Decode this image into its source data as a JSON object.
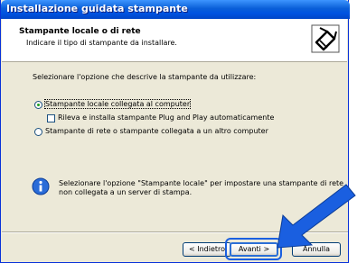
{
  "window": {
    "title": "Installazione guidata stampante"
  },
  "header": {
    "title": "Stampante locale o di rete",
    "subtitle": "Indicare il tipo di stampante da installare.",
    "icon": "printer-wizard-icon"
  },
  "body": {
    "prompt": "Selezionare l'opzione che descrive la stampante da utilizzare:",
    "option_local": "Stampante locale collegata al computer",
    "option_local_selected": true,
    "checkbox_pnp": "Rileva e installa stampante Plug and Play automaticamente",
    "checkbox_pnp_checked": false,
    "option_network": "Stampante di rete o stampante collegata a un altro computer",
    "info_text_line1": "Selezionare l'opzione \"Stampante locale\" per impostare una stampante di rete",
    "info_text_line2": "non collegata a un server di stampa."
  },
  "buttons": {
    "back": "< Indietro",
    "next": "Avanti >",
    "cancel": "Annulla"
  },
  "annotation": {
    "arrow_color": "#1a5fe0",
    "highlight_color": "#1a5fe0"
  }
}
